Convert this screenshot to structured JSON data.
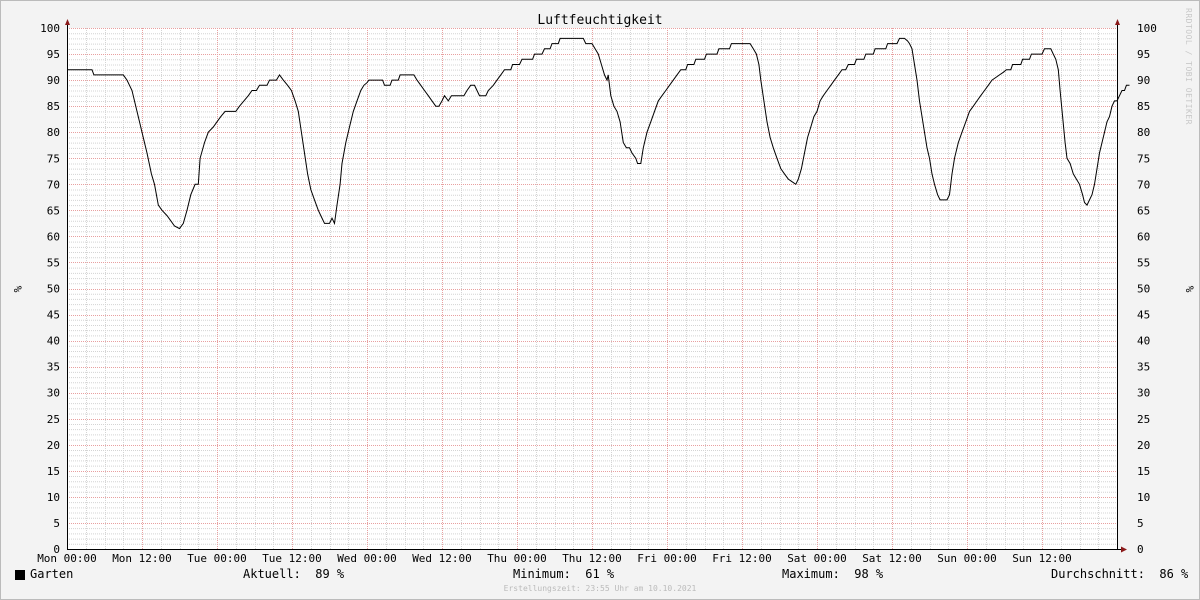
{
  "chart_data": {
    "type": "line",
    "title": "Luftfeuchtigkeit",
    "ylabel": "%",
    "ylim": [
      0,
      100
    ],
    "yticks": [
      0,
      5,
      10,
      15,
      20,
      25,
      30,
      35,
      40,
      45,
      50,
      55,
      60,
      65,
      70,
      75,
      80,
      85,
      90,
      95,
      100
    ],
    "xlim": [
      0,
      168
    ],
    "xticks": [
      {
        "x": 0,
        "label": "Mon 00:00"
      },
      {
        "x": 12,
        "label": "Mon 12:00"
      },
      {
        "x": 24,
        "label": "Tue 00:00"
      },
      {
        "x": 36,
        "label": "Tue 12:00"
      },
      {
        "x": 48,
        "label": "Wed 00:00"
      },
      {
        "x": 60,
        "label": "Wed 12:00"
      },
      {
        "x": 72,
        "label": "Thu 00:00"
      },
      {
        "x": 84,
        "label": "Thu 12:00"
      },
      {
        "x": 96,
        "label": "Fri 00:00"
      },
      {
        "x": 108,
        "label": "Fri 12:00"
      },
      {
        "x": 120,
        "label": "Sat 00:00"
      },
      {
        "x": 132,
        "label": "Sat 12:00"
      },
      {
        "x": 144,
        "label": "Sun 00:00"
      },
      {
        "x": 156,
        "label": "Sun 12:00"
      }
    ],
    "grid": true,
    "series": [
      {
        "name": "Garten",
        "color": "#000000",
        "points": [
          [
            0,
            92
          ],
          [
            4,
            92
          ],
          [
            4.3,
            91
          ],
          [
            9,
            91
          ],
          [
            9.6,
            90
          ],
          [
            10.4,
            88
          ],
          [
            11.2,
            84
          ],
          [
            12,
            80
          ],
          [
            12.8,
            76
          ],
          [
            13.5,
            72
          ],
          [
            14,
            70
          ],
          [
            14.6,
            66
          ],
          [
            15.2,
            65
          ],
          [
            16,
            64
          ],
          [
            16.6,
            63
          ],
          [
            17.2,
            62
          ],
          [
            18,
            61.5
          ],
          [
            18.6,
            62.5
          ],
          [
            19.2,
            65
          ],
          [
            19.8,
            68
          ],
          [
            20.5,
            70
          ],
          [
            21,
            70
          ],
          [
            21.3,
            75
          ],
          [
            22,
            78
          ],
          [
            22.6,
            80
          ],
          [
            23.4,
            81
          ],
          [
            24,
            82
          ],
          [
            24.6,
            83
          ],
          [
            25.3,
            84
          ],
          [
            27,
            84
          ],
          [
            27.6,
            85
          ],
          [
            28.3,
            86
          ],
          [
            29,
            87
          ],
          [
            29.6,
            88
          ],
          [
            30.3,
            88
          ],
          [
            30.8,
            89
          ],
          [
            32,
            89
          ],
          [
            32.4,
            90
          ],
          [
            33.5,
            90
          ],
          [
            34,
            91
          ],
          [
            34.6,
            90
          ],
          [
            35.3,
            89
          ],
          [
            35.9,
            88
          ],
          [
            36.5,
            86
          ],
          [
            37,
            84
          ],
          [
            37.5,
            80
          ],
          [
            38,
            76
          ],
          [
            38.5,
            72
          ],
          [
            39,
            69
          ],
          [
            39.6,
            67
          ],
          [
            40.2,
            65
          ],
          [
            40.6,
            64
          ],
          [
            41.2,
            62.5
          ],
          [
            42,
            62.5
          ],
          [
            42.4,
            63.5
          ],
          [
            42.8,
            62.5
          ],
          [
            43.2,
            66
          ],
          [
            43.7,
            70
          ],
          [
            44,
            74
          ],
          [
            44.6,
            78
          ],
          [
            45.2,
            81
          ],
          [
            45.8,
            84
          ],
          [
            46.4,
            86
          ],
          [
            47,
            88
          ],
          [
            47.5,
            89
          ],
          [
            48,
            89.5
          ],
          [
            48.3,
            90
          ],
          [
            50.5,
            90
          ],
          [
            50.8,
            89
          ],
          [
            51.7,
            89
          ],
          [
            52,
            90
          ],
          [
            53,
            90
          ],
          [
            53.3,
            91
          ],
          [
            55.5,
            91
          ],
          [
            56,
            90
          ],
          [
            56.6,
            89
          ],
          [
            57.2,
            88
          ],
          [
            57.8,
            87
          ],
          [
            58.4,
            86
          ],
          [
            59,
            85
          ],
          [
            59.5,
            85
          ],
          [
            60,
            86
          ],
          [
            60.4,
            87
          ],
          [
            61,
            86
          ],
          [
            61.5,
            87
          ],
          [
            63.5,
            87
          ],
          [
            64,
            88
          ],
          [
            64.6,
            89
          ],
          [
            65.2,
            89
          ],
          [
            65.6,
            88
          ],
          [
            66,
            87
          ],
          [
            67,
            87
          ],
          [
            67.4,
            88
          ],
          [
            68.2,
            89
          ],
          [
            68.8,
            90
          ],
          [
            69.4,
            91
          ],
          [
            70,
            92
          ],
          [
            71,
            92
          ],
          [
            71.3,
            93
          ],
          [
            72.4,
            93
          ],
          [
            72.8,
            94
          ],
          [
            74.5,
            94
          ],
          [
            74.8,
            95
          ],
          [
            76,
            95
          ],
          [
            76.4,
            96
          ],
          [
            77.3,
            96
          ],
          [
            77.6,
            97
          ],
          [
            78.6,
            97
          ],
          [
            78.9,
            98
          ],
          [
            82.6,
            98
          ],
          [
            83,
            97
          ],
          [
            84,
            97
          ],
          [
            84.5,
            96
          ],
          [
            85,
            95
          ],
          [
            85.5,
            93
          ],
          [
            86,
            91
          ],
          [
            86.4,
            90
          ],
          [
            86.6,
            91
          ],
          [
            87,
            87
          ],
          [
            87.5,
            85
          ],
          [
            88,
            84
          ],
          [
            88.5,
            82
          ],
          [
            89,
            78
          ],
          [
            89.5,
            77
          ],
          [
            90,
            77
          ],
          [
            90.4,
            76
          ],
          [
            91,
            75
          ],
          [
            91.3,
            74
          ],
          [
            91.8,
            74
          ],
          [
            92.2,
            77
          ],
          [
            92.8,
            80
          ],
          [
            93.4,
            82
          ],
          [
            94,
            84
          ],
          [
            94.6,
            86
          ],
          [
            95.2,
            87
          ],
          [
            95.8,
            88
          ],
          [
            96.4,
            89
          ],
          [
            97,
            90
          ],
          [
            97.6,
            91
          ],
          [
            98.2,
            92
          ],
          [
            99,
            92
          ],
          [
            99.3,
            93
          ],
          [
            100.3,
            93
          ],
          [
            100.6,
            94
          ],
          [
            102,
            94
          ],
          [
            102.3,
            95
          ],
          [
            104,
            95
          ],
          [
            104.3,
            96
          ],
          [
            106,
            96
          ],
          [
            106.3,
            97
          ],
          [
            109.3,
            97
          ],
          [
            109.8,
            96
          ],
          [
            110.3,
            95
          ],
          [
            110.7,
            93
          ],
          [
            111,
            90
          ],
          [
            111.5,
            86
          ],
          [
            112,
            82
          ],
          [
            112.5,
            79
          ],
          [
            113,
            77
          ],
          [
            113.6,
            75
          ],
          [
            114.2,
            73
          ],
          [
            114.8,
            72
          ],
          [
            115.4,
            71
          ],
          [
            116,
            70.5
          ],
          [
            116.6,
            70
          ],
          [
            117,
            71
          ],
          [
            117.5,
            73
          ],
          [
            118,
            76
          ],
          [
            118.5,
            79
          ],
          [
            119,
            81
          ],
          [
            119.5,
            83
          ],
          [
            120,
            84
          ],
          [
            120.5,
            86
          ],
          [
            121,
            87
          ],
          [
            121.6,
            88
          ],
          [
            122.2,
            89
          ],
          [
            122.8,
            90
          ],
          [
            123.4,
            91
          ],
          [
            124,
            92
          ],
          [
            124.6,
            92
          ],
          [
            125,
            93
          ],
          [
            126,
            93
          ],
          [
            126.3,
            94
          ],
          [
            127.5,
            94
          ],
          [
            127.8,
            95
          ],
          [
            129,
            95
          ],
          [
            129.3,
            96
          ],
          [
            131,
            96
          ],
          [
            131.3,
            97
          ],
          [
            132.8,
            97
          ],
          [
            133.2,
            98
          ],
          [
            134,
            98
          ],
          [
            134.5,
            97.5
          ],
          [
            134.8,
            97
          ],
          [
            135.2,
            96
          ],
          [
            135.6,
            93
          ],
          [
            136,
            90
          ],
          [
            136.4,
            86
          ],
          [
            136.8,
            83
          ],
          [
            137.2,
            80
          ],
          [
            137.6,
            77
          ],
          [
            138,
            75
          ],
          [
            138.4,
            72
          ],
          [
            138.8,
            70
          ],
          [
            139.3,
            68
          ],
          [
            139.7,
            67
          ],
          [
            140.8,
            67
          ],
          [
            141.2,
            68
          ],
          [
            141.6,
            72
          ],
          [
            142,
            75
          ],
          [
            142.6,
            78
          ],
          [
            143.2,
            80
          ],
          [
            143.8,
            82
          ],
          [
            144.4,
            84
          ],
          [
            145,
            85
          ],
          [
            145.6,
            86
          ],
          [
            146.2,
            87
          ],
          [
            146.8,
            88
          ],
          [
            147.4,
            89
          ],
          [
            148,
            90
          ],
          [
            148.6,
            90.5
          ],
          [
            149.2,
            91
          ],
          [
            149.8,
            91.5
          ],
          [
            150.3,
            92
          ],
          [
            151,
            92
          ],
          [
            151.3,
            93
          ],
          [
            152.6,
            93
          ],
          [
            152.9,
            94
          ],
          [
            154,
            94
          ],
          [
            154.3,
            95
          ],
          [
            156,
            95
          ],
          [
            156.4,
            96
          ],
          [
            157.4,
            96
          ],
          [
            157.8,
            95
          ],
          [
            158.2,
            94
          ],
          [
            158.6,
            92
          ],
          [
            158.9,
            88
          ],
          [
            159.3,
            83
          ],
          [
            159.7,
            78
          ],
          [
            160,
            75
          ],
          [
            160.5,
            74
          ],
          [
            161,
            72
          ],
          [
            161.5,
            71
          ],
          [
            162,
            70
          ],
          [
            162.5,
            68
          ],
          [
            162.8,
            66.5
          ],
          [
            163.2,
            66
          ],
          [
            163.6,
            67
          ],
          [
            164,
            68
          ],
          [
            164.4,
            70
          ],
          [
            164.8,
            73
          ],
          [
            165.2,
            76
          ],
          [
            165.6,
            78
          ],
          [
            166,
            80
          ],
          [
            166.4,
            82
          ],
          [
            166.8,
            83
          ],
          [
            167.2,
            85
          ],
          [
            167.6,
            86
          ],
          [
            168,
            86
          ],
          [
            168.4,
            87
          ],
          [
            168.8,
            88
          ],
          [
            169.2,
            88
          ],
          [
            169.5,
            89
          ],
          [
            170,
            89
          ]
        ]
      }
    ]
  },
  "legend": {
    "series_name": "Garten",
    "aktuell": "Aktuell:  89 %",
    "minimum": "Minimum:  61 %",
    "maximum": "Maximum:  98 %",
    "durchschnitt": "Durchschnitt:  86 %"
  },
  "footer": "Erstellungszeit: 23:55 Uhr am 10.10.2021",
  "watermark": "RRDTOOL / TOBI OETIKER",
  "colors": {
    "major_grid": "#e8a0a0",
    "minor_grid": "#d4d4d4",
    "plot_bg": "#ffffff",
    "axis": "#000000",
    "arrow": "#8b1a1a"
  }
}
